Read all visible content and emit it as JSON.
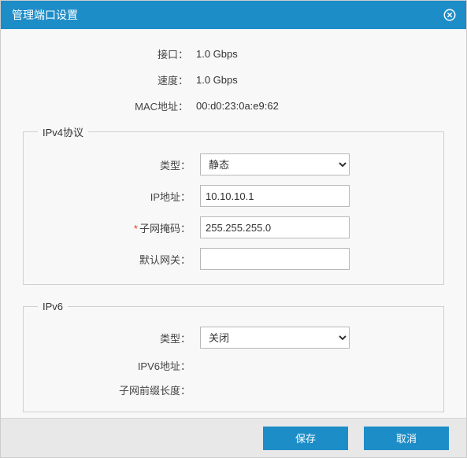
{
  "dialog": {
    "title": "管理端口设置"
  },
  "info": {
    "interface_label": "接口：",
    "interface_value": "1.0 Gbps",
    "speed_label": "速度：",
    "speed_value": "1.0 Gbps",
    "mac_label": "MAC地址：",
    "mac_value": "00:d0:23:0a:e9:62"
  },
  "ipv4": {
    "legend": "IPv4协议",
    "type_label": "类型：",
    "type_value": "静态",
    "type_options": [
      "静态"
    ],
    "ip_label": "IP地址：",
    "ip_value": "10.10.10.1",
    "mask_label": "子网掩码：",
    "mask_required_mark": "*",
    "mask_value": "255.255.255.0",
    "gateway_label": "默认网关：",
    "gateway_value": ""
  },
  "ipv6": {
    "legend": "IPv6",
    "type_label": "类型：",
    "type_value": "关闭",
    "type_options": [
      "关闭"
    ],
    "addr_label": "IPV6地址：",
    "addr_value": "",
    "prefix_label": "子网前缀长度：",
    "prefix_value": ""
  },
  "footer": {
    "save_label": "保存",
    "cancel_label": "取消"
  }
}
